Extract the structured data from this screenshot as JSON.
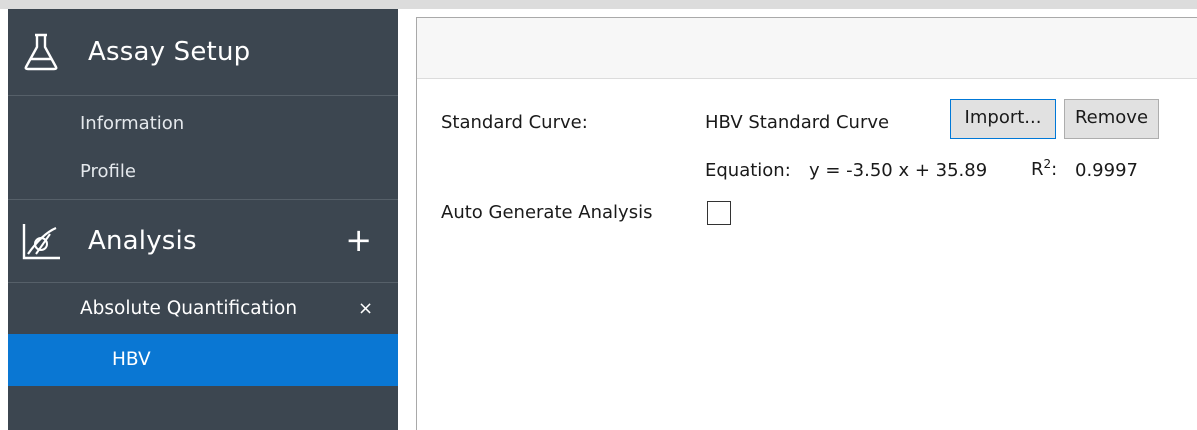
{
  "sidebar": {
    "assay_setup": {
      "title": "Assay Setup",
      "icon": "flask-icon",
      "items": [
        {
          "label": "Information"
        },
        {
          "label": "Profile"
        }
      ]
    },
    "analysis": {
      "title": "Analysis",
      "icon": "chart-curve-icon",
      "add_glyph": "+",
      "group": {
        "label": "Absolute Quantification",
        "close_glyph": "×",
        "items": [
          {
            "label": "HBV",
            "selected": true
          }
        ]
      }
    }
  },
  "main": {
    "standard_curve_label": "Standard Curve:",
    "standard_curve_name": "HBV Standard Curve",
    "import_button": "Import...",
    "remove_button": "Remove",
    "equation_label": "Equation:",
    "equation_value": "y = -3.50 x + 35.89",
    "r2_label_base": "R",
    "r2_label_sup": "2",
    "r2_label_colon": ":",
    "r2_value": "0.9997",
    "auto_generate_label": "Auto Generate Analysis",
    "auto_generate_checked": false
  },
  "colors": {
    "sidebar_bg": "#3c4650",
    "selected_bg": "#0a77d3",
    "focus_border": "#0078d7"
  }
}
